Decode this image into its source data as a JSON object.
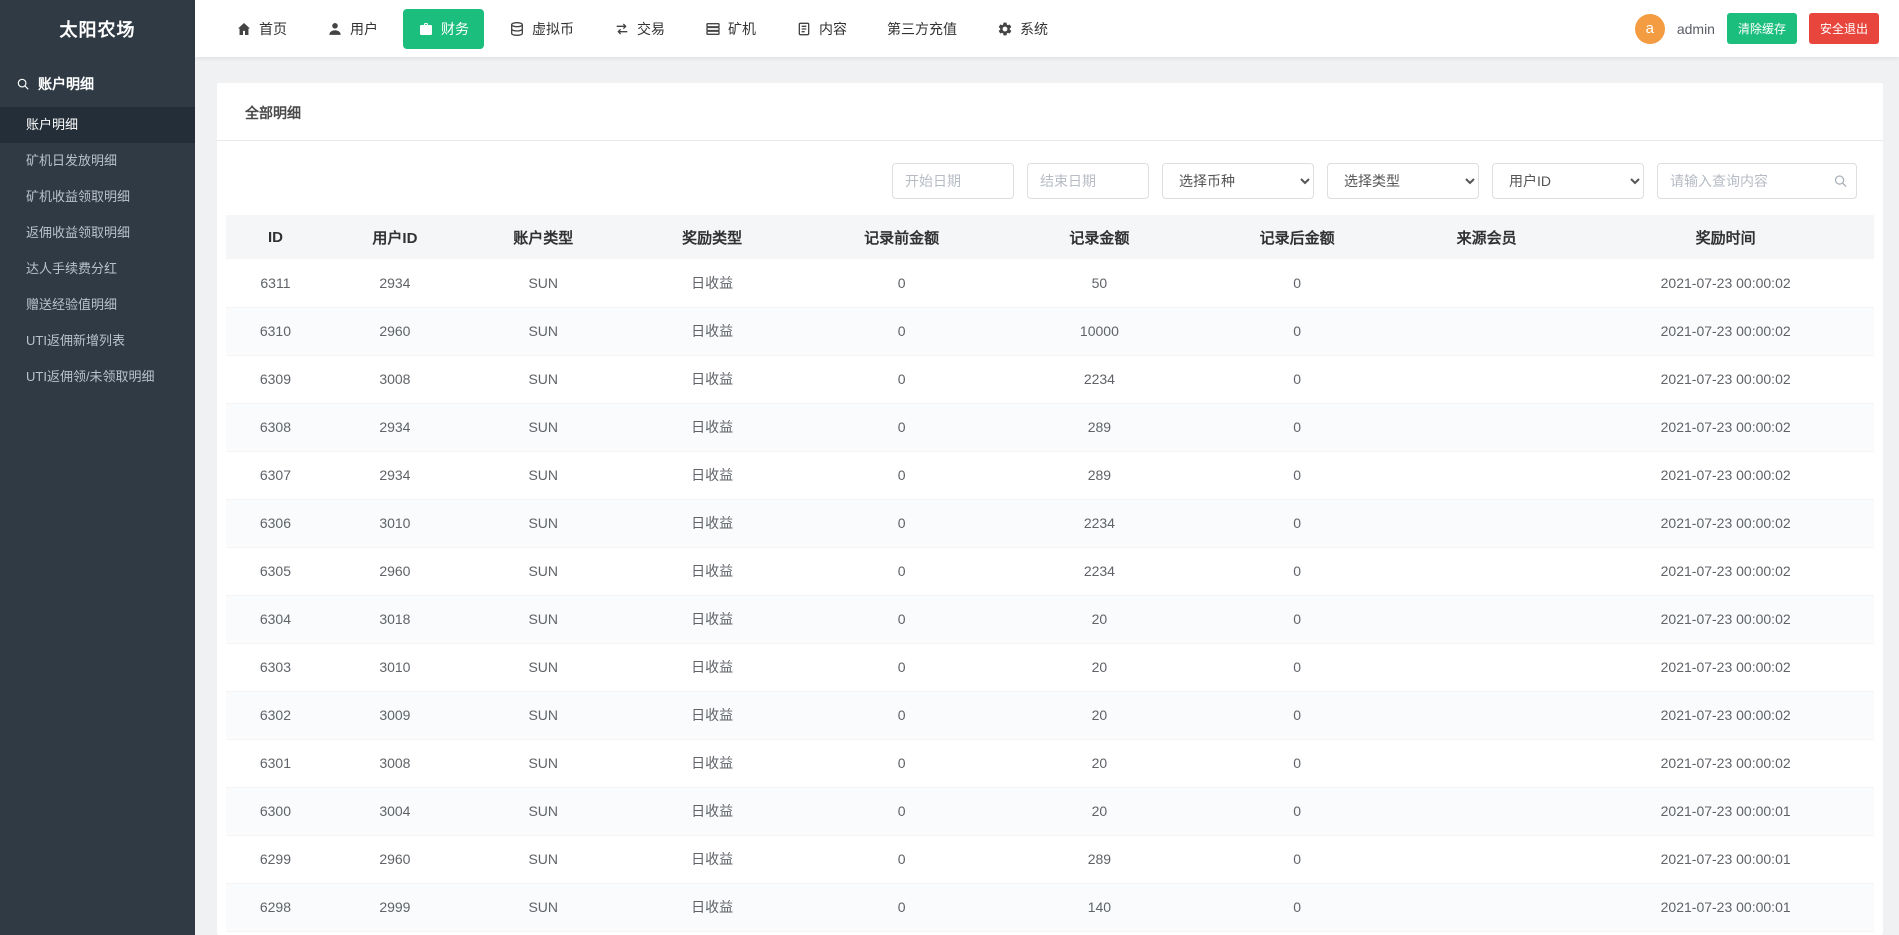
{
  "colors": {
    "accent": "#1cbe7e",
    "danger": "#e8453c",
    "avatar": "#f39c41",
    "sidebar": "#2f3a45"
  },
  "app": {
    "title": "太阳农场"
  },
  "topnav": {
    "items": [
      {
        "id": "home",
        "label": "首页",
        "icon": "home-icon",
        "active": false
      },
      {
        "id": "user",
        "label": "用户",
        "icon": "user-icon",
        "active": false
      },
      {
        "id": "finance",
        "label": "财务",
        "icon": "finance-icon",
        "active": true
      },
      {
        "id": "coin",
        "label": "虚拟币",
        "icon": "coins-icon",
        "active": false
      },
      {
        "id": "trade",
        "label": "交易",
        "icon": "exchange-icon",
        "active": false
      },
      {
        "id": "miner",
        "label": "矿机",
        "icon": "miner-icon",
        "active": false
      },
      {
        "id": "content",
        "label": "内容",
        "icon": "content-icon",
        "active": false
      },
      {
        "id": "recharge",
        "label": "第三方充值",
        "icon": null,
        "active": false
      },
      {
        "id": "system",
        "label": "系统",
        "icon": "gear-icon",
        "active": false
      }
    ],
    "user": {
      "avatar_letter": "a",
      "name": "admin"
    },
    "clear_cache_label": "清除缓存",
    "logout_label": "安全退出"
  },
  "sidebar": {
    "section_title": "账户明细",
    "section_icon": "search-icon",
    "items": [
      {
        "id": "account-detail",
        "label": "账户明细",
        "active": true
      },
      {
        "id": "miner-daily",
        "label": "矿机日发放明细",
        "active": false
      },
      {
        "id": "miner-income",
        "label": "矿机收益领取明细",
        "active": false
      },
      {
        "id": "rebate-income",
        "label": "返佣收益领取明细",
        "active": false
      },
      {
        "id": "expert-fee",
        "label": "达人手续费分红",
        "active": false
      },
      {
        "id": "gift-exp",
        "label": "赠送经验值明细",
        "active": false
      },
      {
        "id": "uti-new",
        "label": "UTI返佣新增列表",
        "active": false
      },
      {
        "id": "uti-claim",
        "label": "UTI返佣领/未领取明细",
        "active": false
      }
    ]
  },
  "content": {
    "tab": "全部明细",
    "filters": {
      "start_date_placeholder": "开始日期",
      "end_date_placeholder": "结束日期",
      "coin_select": "选择币种",
      "type_select": "选择类型",
      "user_select": "用户ID",
      "search_placeholder": "请输入查询内容",
      "search_icon": "search-icon"
    },
    "table": {
      "columns": [
        "ID",
        "用户ID",
        "账户类型",
        "奖励类型",
        "记录前金额",
        "记录金额",
        "记录后金额",
        "来源会员",
        "奖励时间"
      ],
      "rows": [
        [
          "6311",
          "2934",
          "SUN",
          "日收益",
          "0",
          "50",
          "0",
          "",
          "2021-07-23 00:00:02"
        ],
        [
          "6310",
          "2960",
          "SUN",
          "日收益",
          "0",
          "10000",
          "0",
          "",
          "2021-07-23 00:00:02"
        ],
        [
          "6309",
          "3008",
          "SUN",
          "日收益",
          "0",
          "2234",
          "0",
          "",
          "2021-07-23 00:00:02"
        ],
        [
          "6308",
          "2934",
          "SUN",
          "日收益",
          "0",
          "289",
          "0",
          "",
          "2021-07-23 00:00:02"
        ],
        [
          "6307",
          "2934",
          "SUN",
          "日收益",
          "0",
          "289",
          "0",
          "",
          "2021-07-23 00:00:02"
        ],
        [
          "6306",
          "3010",
          "SUN",
          "日收益",
          "0",
          "2234",
          "0",
          "",
          "2021-07-23 00:00:02"
        ],
        [
          "6305",
          "2960",
          "SUN",
          "日收益",
          "0",
          "2234",
          "0",
          "",
          "2021-07-23 00:00:02"
        ],
        [
          "6304",
          "3018",
          "SUN",
          "日收益",
          "0",
          "20",
          "0",
          "",
          "2021-07-23 00:00:02"
        ],
        [
          "6303",
          "3010",
          "SUN",
          "日收益",
          "0",
          "20",
          "0",
          "",
          "2021-07-23 00:00:02"
        ],
        [
          "6302",
          "3009",
          "SUN",
          "日收益",
          "0",
          "20",
          "0",
          "",
          "2021-07-23 00:00:02"
        ],
        [
          "6301",
          "3008",
          "SUN",
          "日收益",
          "0",
          "20",
          "0",
          "",
          "2021-07-23 00:00:02"
        ],
        [
          "6300",
          "3004",
          "SUN",
          "日收益",
          "0",
          "20",
          "0",
          "",
          "2021-07-23 00:00:01"
        ],
        [
          "6299",
          "2960",
          "SUN",
          "日收益",
          "0",
          "289",
          "0",
          "",
          "2021-07-23 00:00:01"
        ],
        [
          "6298",
          "2999",
          "SUN",
          "日收益",
          "0",
          "140",
          "0",
          "",
          "2021-07-23 00:00:01"
        ]
      ]
    }
  }
}
